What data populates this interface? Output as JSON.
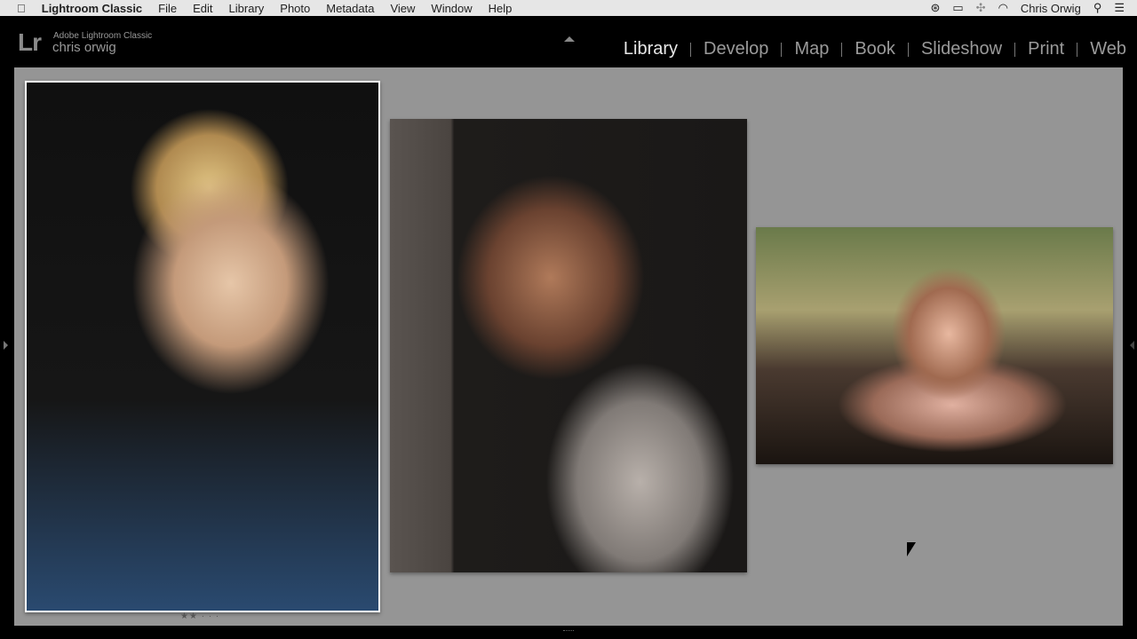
{
  "menubar": {
    "app_name": "Lightroom Classic",
    "items": [
      "File",
      "Edit",
      "Library",
      "Photo",
      "Metadata",
      "View",
      "Window",
      "Help"
    ],
    "user": "Chris Orwig"
  },
  "identity": {
    "logo": "Lr",
    "product": "Adobe Lightroom Classic",
    "user": "chris orwig"
  },
  "modules": [
    "Library",
    "Develop",
    "Map",
    "Book",
    "Slideshow",
    "Print",
    "Web"
  ],
  "active_module": "Library",
  "photos": [
    {
      "rating": 2,
      "max_rating": 5,
      "selected": true
    },
    {
      "selected": false
    },
    {
      "selected": false
    }
  ],
  "rating_display": "★★ · · ·"
}
